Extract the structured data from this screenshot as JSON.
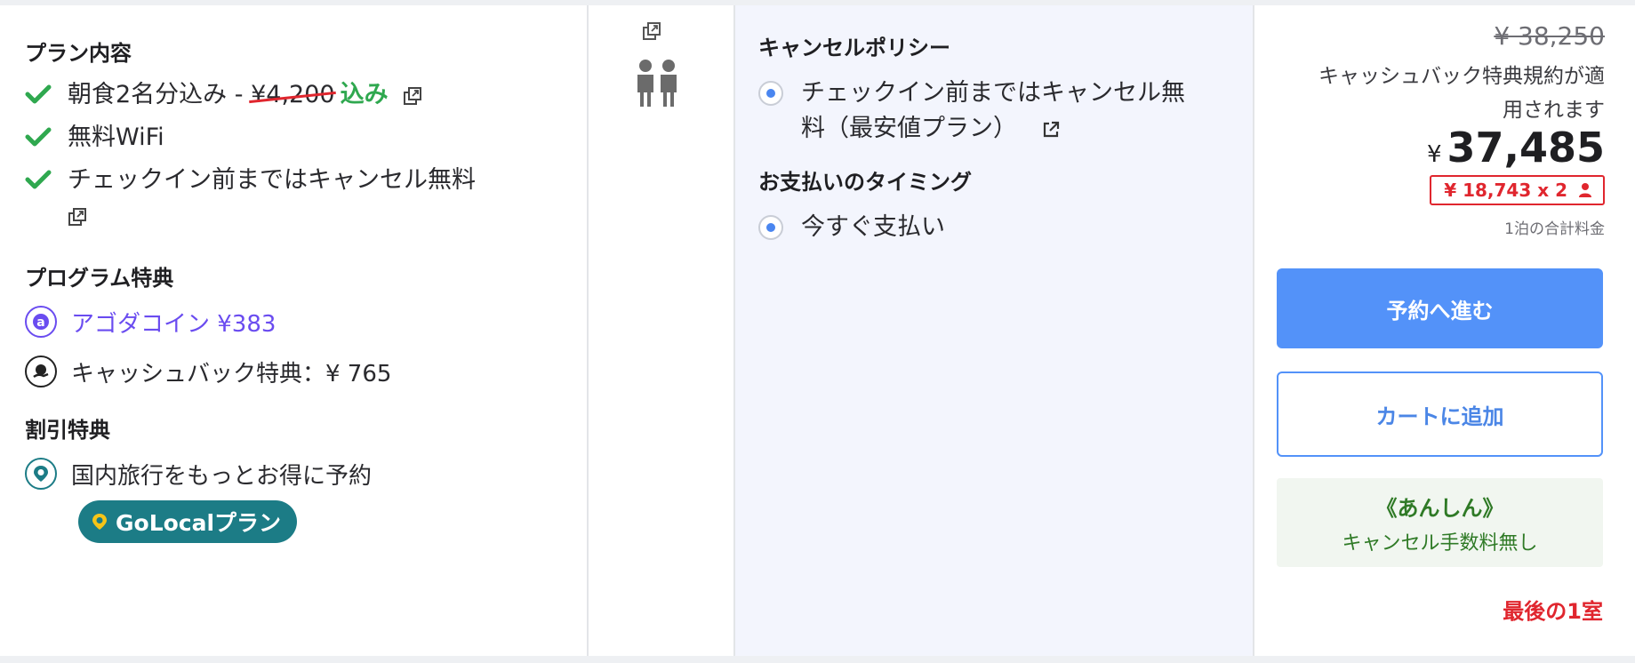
{
  "plan": {
    "heading": "プラン内容",
    "breakfast_label": "朝食2名分込み - ",
    "breakfast_old_price": "¥4,200",
    "breakfast_included": "込み",
    "wifi": "無料WiFi",
    "cancel": "チェックイン前まではキャンセル無料"
  },
  "program": {
    "heading": "プログラム特典",
    "coin": "アゴダコイン ¥383",
    "cashback": "キャッシュバック特典：¥ 765"
  },
  "discount": {
    "heading": "割引特典",
    "local": "国内旅行をもっとお得に予約",
    "badge": "GoLocalプラン"
  },
  "policy": {
    "cancel_heading": "キャンセルポリシー",
    "cancel_line1": "チェックイン前まではキャンセル無",
    "cancel_line2": "料（最安値プラン）",
    "payment_heading": "お支払いのタイミング",
    "payment_option": "今すぐ支払い"
  },
  "price": {
    "original": "¥ 38,250",
    "cashback_note_line1": "キャッシュバック特典規約が適",
    "cashback_note_line2": "用されます",
    "currency": "¥",
    "total": "37,485",
    "per_person": "¥ 18,743 x 2",
    "note": "1泊の合計料金"
  },
  "actions": {
    "book": "予約へ進む",
    "cart": "カートに追加"
  },
  "assurance": {
    "title": "《あんしん》",
    "subtitle": "キャンセル手数料無し"
  },
  "availability": "最後の1室",
  "colors": {
    "primary": "#5392f9",
    "green": "#2fa84f",
    "red": "#e0262e",
    "coin_purple": "#6a4cf0",
    "teal": "#1c7c86"
  }
}
